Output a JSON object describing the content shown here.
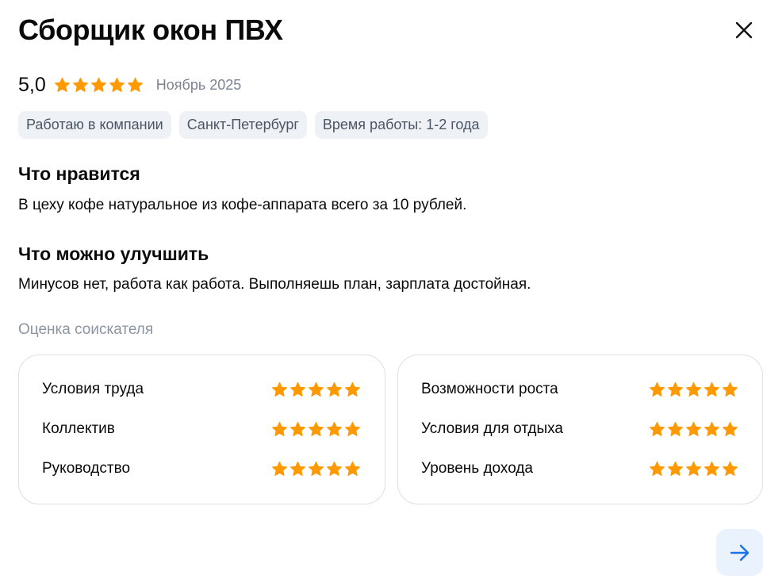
{
  "review": {
    "title": "Сборщик окон ПВХ",
    "rating": "5,0",
    "stars_filled": 5,
    "stars_total": 5,
    "date": "Ноябрь 2025"
  },
  "tags": [
    "Работаю в компании",
    "Санкт-Петербург",
    "Время работы: 1-2 года"
  ],
  "likes": {
    "title": "Что нравится",
    "text": "В цеху кофе натуральное из кофе-аппарата всего за 10 рублей."
  },
  "improve": {
    "title": "Что можно улучшить",
    "text": "Минусов нет, работа как работа. Выполняешь план, зарплата достойная."
  },
  "assessment": {
    "label": "Оценка соискателя",
    "left": [
      {
        "label": "Условия труда",
        "stars": 5
      },
      {
        "label": "Коллектив",
        "stars": 5
      },
      {
        "label": "Руководство",
        "stars": 5
      }
    ],
    "right": [
      {
        "label": "Возможности роста",
        "stars": 5
      },
      {
        "label": "Условия для отдыха",
        "stars": 5
      },
      {
        "label": "Уровень дохода",
        "stars": 5
      }
    ]
  },
  "icons": {
    "close": "close-icon",
    "star": "star-icon",
    "next": "arrow-right-icon"
  },
  "colors": {
    "star": "#ff9900",
    "tag_bg": "#eef1f6",
    "muted_text": "#8c95a2",
    "accent": "#1a73e8",
    "accent_bg": "#e9f2fd"
  }
}
